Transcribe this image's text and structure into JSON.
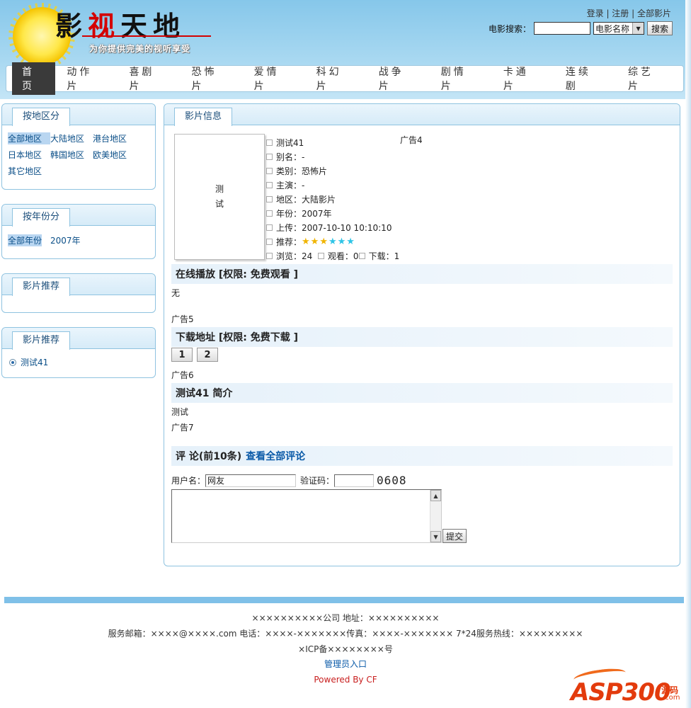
{
  "header": {
    "logo_title": [
      "影",
      "视",
      "天",
      "地"
    ],
    "slogan": "为你提供完美的视听享受",
    "toplinks": [
      "登录",
      "注册",
      "全部影片"
    ],
    "search_label": "电影搜索：",
    "search_value": "",
    "search_select": "电影名称",
    "search_button": "搜索"
  },
  "nav": {
    "items": [
      "首页",
      "动作片",
      "喜剧片",
      "恐怖片",
      "爱情片",
      "科幻片",
      "战争片",
      "剧情片",
      "卡通片",
      "连续剧",
      "综艺片"
    ],
    "active": "首页"
  },
  "sidebar": {
    "region_title": "按地区分",
    "regions": [
      "全部地区",
      "大陆地区",
      "港台地区",
      "日本地区",
      "韩国地区",
      "欧美地区",
      "其它地区"
    ],
    "year_title": "按年份分",
    "years": [
      "全部年份",
      "2007年"
    ],
    "recommend_title_1": "影片推荐",
    "recommend_title_2": "影片推荐",
    "recommend_items": [
      "测试41"
    ]
  },
  "main": {
    "tab_title": "影片信息",
    "poster_text": "测试",
    "ad4": "广告4",
    "info": {
      "name": "测试41",
      "alias": "别名：-",
      "category": "类别：恐怖片",
      "actor": "主演：-",
      "region": "地区：大陆影片",
      "year": "年份：2007年",
      "upload": "上传：2007-10-10 10:10:10",
      "recommend_label": "推荐：",
      "rating": 3,
      "rating_max": 6,
      "views": "浏览：24",
      "watch": "观看：0",
      "download": "下载：1"
    },
    "online_title": "在线播放  [权限: 免费观看 ]",
    "online_content": "无",
    "ad5": "广告5",
    "download_title": "下载地址  [权限: 免费下载 ]",
    "download_buttons": [
      "1",
      "2"
    ],
    "ad6": "广告6",
    "intro_title": "测试41 简介",
    "intro_content": "测试",
    "ad7": "广告7",
    "comment_title": "评 论(前10条)",
    "comment_link": "查看全部评论",
    "username_label": "用户名：",
    "username_value": "网友",
    "captcha_label": "验证码：",
    "captcha_value": "",
    "captcha_code": "0608",
    "submit_label": "提交"
  },
  "footer": {
    "line1": "××××××××××公司 地址：××××××××××",
    "line2": "服务邮箱：××××@××××.com 电话：××××-×××××××传真：××××-××××××× 7*24服务热线：×××××××××",
    "line3": "×ICP备××××××××号",
    "admin_link": "管理员入口",
    "powered": "Powered By CF",
    "watermark": "ASP300",
    "watermark_badge": "源码",
    "watermark_domain": ".com"
  },
  "colors": {
    "header_bg": "#a8d8f1",
    "panel_border": "#8fc3e0",
    "link": "#0b4f88",
    "accent_red": "#d40000"
  }
}
